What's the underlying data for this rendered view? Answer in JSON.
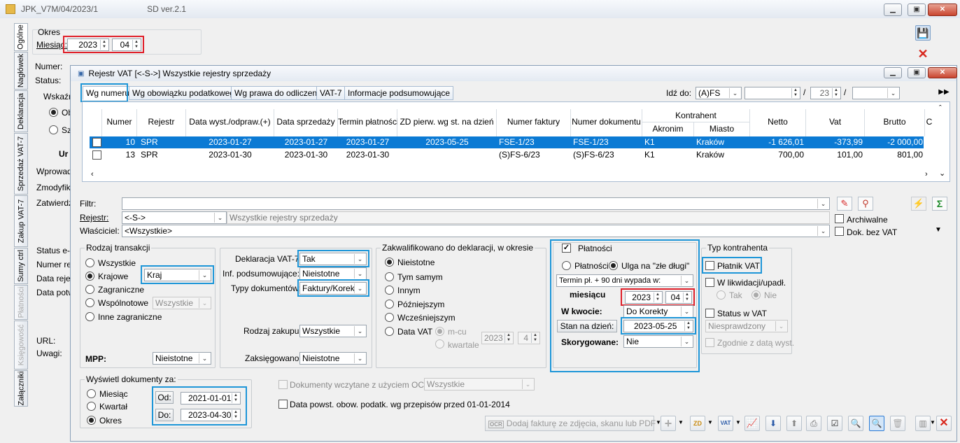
{
  "outer": {
    "title": "JPK_V7M/04/2023/1",
    "version": "SD ver.2.1",
    "okres_label": "Okres",
    "miesiac_label": "Miesiąc:",
    "year": "2023",
    "month": "04",
    "numer_label": "Numer:",
    "status_label": "Status:",
    "wskazn_label": "Wskaźn",
    "radio1": "Ob",
    "radio2": "Sz",
    "ur_label": "Ur",
    "wprowad_label": "Wprowad",
    "zmodyfik_label": "Zmodyfiko",
    "zatwierdz_label": "Zatwierdz",
    "status_e_label": "Status e-d",
    "numer_ref_label": "Numer ref",
    "data_rej_label": "Data rejes",
    "data_potw_label": "Data potw",
    "url_label": "URL:",
    "uwagi_label": "Uwagi:",
    "side_tabs": [
      "Ogólne",
      "Nagłówek",
      "Deklaracja",
      "Sprzedaż VAT-7",
      "Zakup VAT-7",
      "Sumy ctrl",
      "Płatności",
      "Księgowość",
      "Załączniki"
    ]
  },
  "inner": {
    "title": "Rejestr VAT  [<-S->]  Wszystkie rejestry sprzedaży",
    "tabs": [
      "Wg numeru",
      "Wg obowiązku podatkowego",
      "Wg prawa do odliczenia",
      "VAT-7",
      "Informacje podsumowujące"
    ],
    "idz_do_label": "Idź do:",
    "idz_do_value": "(A)FS",
    "idz_num": "23",
    "slash": "/",
    "columns": {
      "numer": "Numer",
      "rejestr": "Rejestr",
      "data_wyst": "Data wyst./odpraw.(+)",
      "data_sprz": "Data sprzedaży",
      "termin": "Termin płatności",
      "zd": "ZD pierw. wg st. na dzień",
      "nr_faktury": "Numer faktury",
      "nr_dok": "Numer dokumentu",
      "kontrahent": "Kontrahent",
      "akronim": "Akronim",
      "miasto": "Miasto",
      "netto": "Netto",
      "vat": "Vat",
      "brutto": "Brutto",
      "c": "C"
    },
    "rows": [
      {
        "numer": "10",
        "rejestr": "SPR",
        "data_wyst": "2023-01-27",
        "data_sprz": "2023-01-27",
        "termin": "2023-01-27",
        "zd": "2023-05-25",
        "nr_faktury": "FSE-1/23",
        "nr_dok": "FSE-1/23",
        "akronim": "K1",
        "miasto": "Kraków",
        "netto": "-1 626,01",
        "vat": "-373,99",
        "brutto": "-2 000,00"
      },
      {
        "numer": "13",
        "rejestr": "SPR",
        "data_wyst": "2023-01-30",
        "data_sprz": "2023-01-30",
        "termin": "2023-01-30",
        "zd": "",
        "nr_faktury": "(S)FS-6/23",
        "nr_dok": "(S)FS-6/23",
        "akronim": "K1",
        "miasto": "Kraków",
        "netto": "700,00",
        "vat": "101,00",
        "brutto": "801,00"
      }
    ],
    "filtr_label": "Filtr:",
    "rejestr_label": "Rejestr:",
    "rejestr_value": "<-S->",
    "rejestr_desc": "Wszystkie rejestry sprzedaży",
    "wlasciciel_label": "Właściciel:",
    "wlasciciel_value": "<Wszystkie>",
    "archiwalne": "Archiwalne",
    "dok_bez_vat": "Dok. bez VAT",
    "rodzaj_transakcji": {
      "title": "Rodzaj transakcji",
      "opts": [
        "Wszystkie",
        "Krajowe",
        "Zagraniczne",
        "Wspólnotowe",
        "Inne zagraniczne"
      ],
      "kraj": "Kraj",
      "wsp_value": "Wszystkie"
    },
    "mpp_label": "MPP:",
    "mpp_value": "Nieistotne",
    "dekl_label": "Deklaracja VAT-7:",
    "dekl_value": "Tak",
    "inf_label": "Inf. podsumowujące:",
    "inf_value": "Nieistotne",
    "typy_label": "Typy dokumentów:",
    "typy_value": "Faktury/Korekty",
    "rodzaj_zak_label": "Rodzaj zakupu:",
    "rodzaj_zak_value": "Wszystkie",
    "zaksieg_label": "Zaksięgowano:",
    "zaksieg_value": "Nieistotne",
    "zakw": {
      "title": "Zakwalifikowano do deklaracji, w okresie",
      "opts": [
        "Nieistotne",
        "Tym samym",
        "Innym",
        "Późniejszym",
        "Wcześniejszym",
        "Data VAT"
      ],
      "mcu": "m-cu",
      "kwartale": "kwartale",
      "year": "2023",
      "num": "4"
    },
    "platnosci": {
      "title": "Płatności",
      "check": "✓",
      "r1": "Płatności",
      "r2": "Ulga na \"złe długi\"",
      "termin": "Termin pł. + 90 dni wypada w:",
      "miesiacu": "miesiącu",
      "year": "2023",
      "month": "04",
      "w_kwocie_label": "W kwocie:",
      "w_kwocie_value": "Do Korekty",
      "stan_label": "Stan na dzień:",
      "stan_value": "2023-05-25",
      "skoryg_label": "Skorygowane:",
      "skoryg_value": "Nie"
    },
    "typ_kontr": {
      "title": "Typ kontrahenta",
      "platnik": "Płatnik VAT",
      "likw": "W likwidacji/upadł.",
      "tak": "Tak",
      "nie": "Nie",
      "status": "Status w VAT",
      "niespr": "Niesprawdzony",
      "zgodnie": "Zgodnie z datą wyst."
    },
    "wyswietl": {
      "title": "Wyświetl dokumenty za:",
      "opts": [
        "Miesiąc",
        "Kwartał",
        "Okres"
      ],
      "od_label": "Od:",
      "od_value": "2021-01-01",
      "do_label": "Do:",
      "do_value": "2023-04-30"
    },
    "ocr_label": "Dokumenty wczytane z użyciem OCR",
    "ocr_value": "Wszystkie",
    "data_powst": "Data powst. obow. podatk. wg przepisów przed 01-01-2014",
    "add_photo": "Dodaj fakturę ze zdjęcia, skanu lub PDF",
    "ocr_icon": "OCR"
  }
}
